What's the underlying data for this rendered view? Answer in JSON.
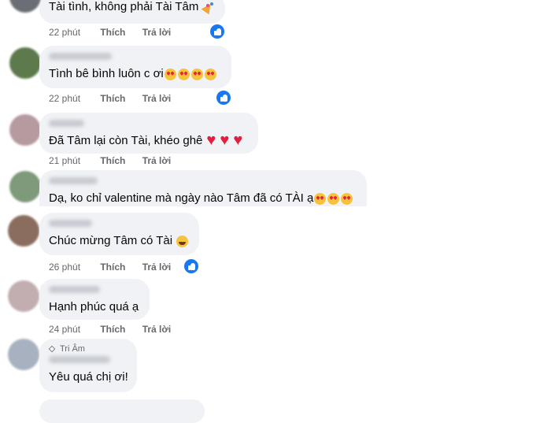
{
  "colors": {
    "accent": "#1877f2",
    "bubble": "#f0f2f5",
    "meta": "#65676b"
  },
  "actions": {
    "like": "Thích",
    "reply": "Trả lời"
  },
  "comments": [
    {
      "text": "Tài tình, không phải Tài Tâm",
      "emojis": [
        "party-popper-icon"
      ],
      "time": "22 phút",
      "liked": true
    },
    {
      "text": "Tình bê bình luôn c ơi",
      "emojis": [
        "smiling-face-with-hearts-icon",
        "smiling-face-with-hearts-icon",
        "smiling-face-with-hearts-icon",
        "smiling-face-with-hearts-icon"
      ],
      "time": "22 phút",
      "liked": true
    },
    {
      "text": "Đã Tâm lại còn Tài, khéo ghê",
      "emojis": [
        "red-heart-icon",
        "red-heart-icon",
        "red-heart-icon"
      ],
      "time": "21 phút",
      "liked": false
    },
    {
      "text": "Dạ, ko chỉ valentine mà ngày nào Tâm đã có TÀI ạ",
      "emojis": [
        "heart-eyes-icon",
        "heart-eyes-icon",
        "heart-eyes-icon"
      ],
      "time": "",
      "liked": false
    },
    {
      "text": "Chúc mừng Tâm có Tài",
      "emojis": [
        "grinning-squinting-face-icon"
      ],
      "time": "26 phút",
      "liked": true
    },
    {
      "text": "Hạnh phúc quá ạ",
      "emojis": [],
      "time": "24 phút",
      "liked": false
    },
    {
      "badge": "Tri Âm",
      "text": "Yêu quá chị ơi!",
      "emojis": [],
      "time": "",
      "liked": false
    }
  ]
}
